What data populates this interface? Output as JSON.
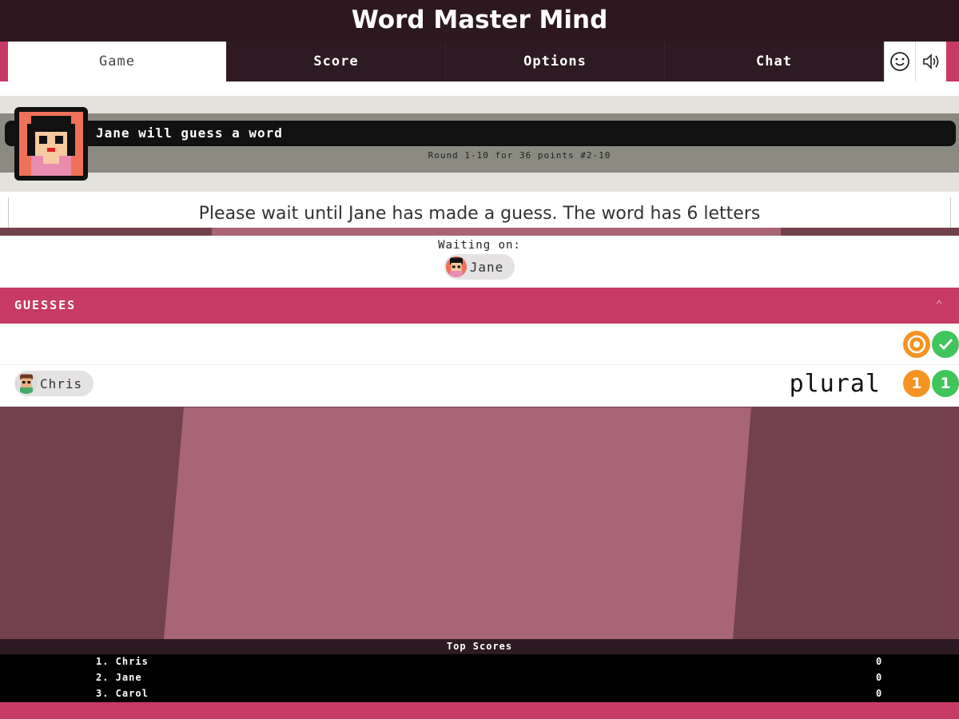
{
  "header": {
    "title": "Word Master Mind"
  },
  "tabs": [
    {
      "label": "Game",
      "active": true
    },
    {
      "label": "Score",
      "active": false
    },
    {
      "label": "Options",
      "active": false
    },
    {
      "label": "Chat",
      "active": false
    }
  ],
  "tab_icons": [
    "smiley-icon",
    "speaker-icon"
  ],
  "status": {
    "player_message": "Jane will guess a word",
    "round_info": "Round 1-10 for 36 points #2-10",
    "wait_message": "Please wait until Jane has made a guess. The word has 6 letters"
  },
  "waiting": {
    "label": "Waiting on:",
    "player": "Jane"
  },
  "guesses": {
    "title": "GUESSES",
    "rows": [
      {
        "player": "Chris",
        "word": "plural",
        "orange_count": "1",
        "green_count": "1"
      }
    ]
  },
  "top_scores": {
    "title": "Top Scores",
    "entries": [
      {
        "rank_name": "1. Chris",
        "score": "0"
      },
      {
        "rank_name": "2. Jane",
        "score": "0"
      },
      {
        "rank_name": "3. Carol",
        "score": "0"
      }
    ]
  },
  "colors": {
    "accent": "#c83a66",
    "dark": "#2e1a22",
    "orange": "#f59322",
    "green": "#3fc55a"
  }
}
